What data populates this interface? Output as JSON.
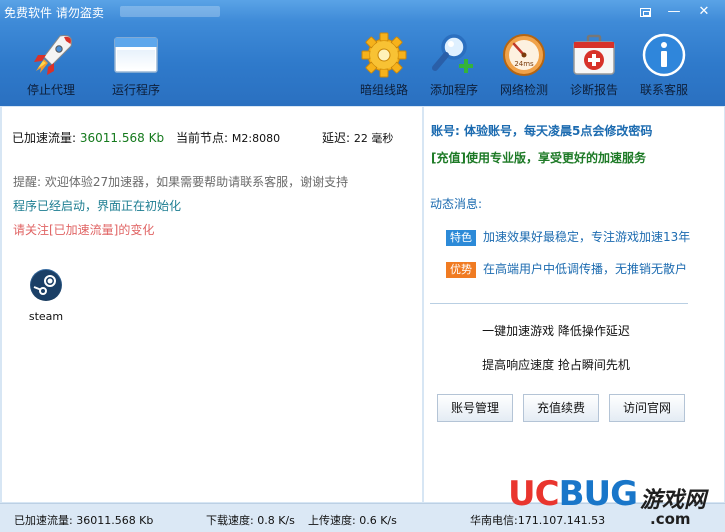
{
  "window": {
    "title": "免费软件 请勿盗卖"
  },
  "toolbar": {
    "items": [
      {
        "label": "停止代理",
        "icon": "rocket-icon"
      },
      {
        "label": "运行程序",
        "icon": "window-icon"
      },
      {
        "label": "暗组线路",
        "icon": "gear-icon"
      },
      {
        "label": "添加程序",
        "icon": "magnifier-plus-icon"
      },
      {
        "label": "网络检测",
        "icon": "speedometer-icon"
      },
      {
        "label": "诊断报告",
        "icon": "first-aid-kit-icon"
      },
      {
        "label": "联系客服",
        "icon": "info-icon"
      }
    ],
    "speed_badge": "24ms"
  },
  "left": {
    "traffic_label": "已加速流量:",
    "traffic_value": "36011.568 Kb",
    "node_label": "当前节点:",
    "node_value": "M2:8080",
    "latency_label": "延迟:",
    "latency_value": "22 毫秒",
    "messages": [
      "提醒: 欢迎体验27加速器，如果需要帮助请联系客服，谢谢支持",
      "程序已经启动，界面正在初始化",
      "请关注[已加速流量]的变化"
    ],
    "game": {
      "label": "steam",
      "icon": "steam-icon"
    }
  },
  "right": {
    "account": "账号: 体验账号，每天凌晨5点会修改密码",
    "vip": "[充值]使用专业版，享受更好的加速服务",
    "news_title": "动态消息:",
    "news": [
      {
        "tag": "特色",
        "text": "加速效果好最稳定，专注游戏加速13年",
        "tag_color": "#2c8ad8"
      },
      {
        "tag": "优势",
        "text": "在高端用户中低调传播，无推销无散户",
        "tag_color": "#f07b22"
      }
    ],
    "promo1": "一键加速游戏  降低操作延迟",
    "promo2": "提高响应速度  抢占瞬间先机",
    "buttons": [
      "账号管理",
      "充值续费",
      "访问官网"
    ]
  },
  "statusbar": {
    "traffic": "已加速流量: 36011.568 Kb",
    "download": "下载速度: 0.8 K/s",
    "upload": "上传速度: 0.6 K/s",
    "server": "华南电信:171.107.141.53"
  },
  "watermark": {
    "uc": "UC",
    "bug": "BUG",
    "cn": "游戏网",
    "com": ".com"
  }
}
